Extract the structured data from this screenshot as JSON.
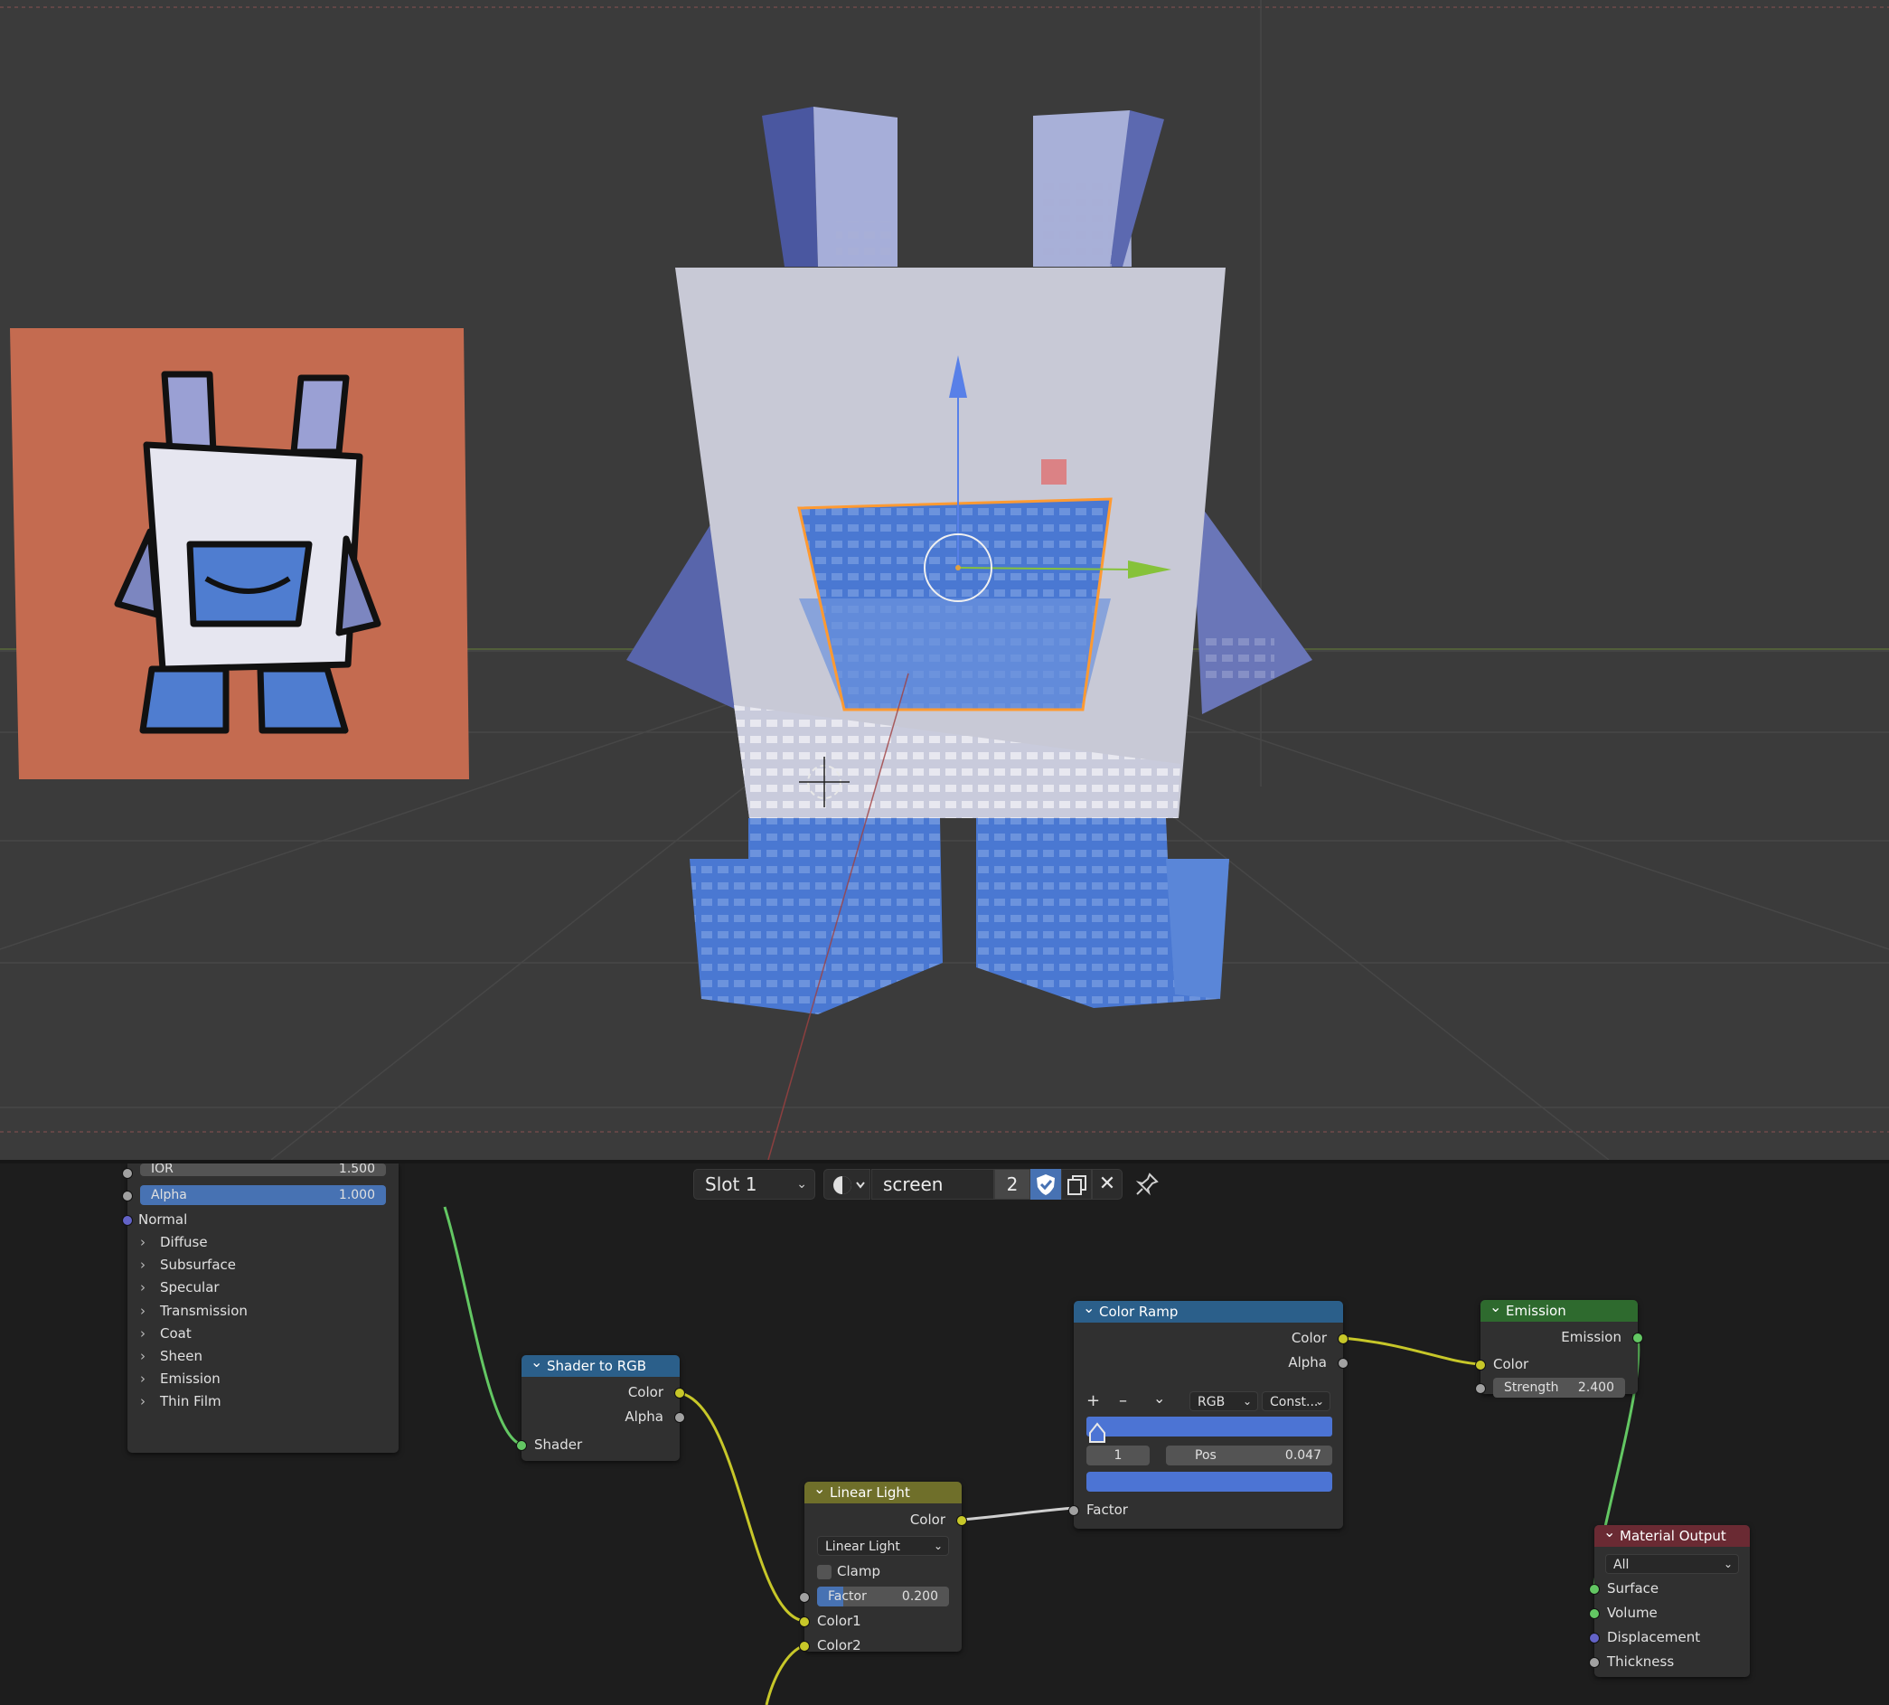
{
  "header": {
    "slot_label": "Slot 1",
    "material_name": "screen",
    "users_count": "2",
    "icons": [
      "material-sphere-icon",
      "fake-user-shield-icon",
      "duplicate-material-icon",
      "unlink-x-icon",
      "pin-icon"
    ]
  },
  "principled_panel": {
    "ior_label": "IOR",
    "ior_value": "1.500",
    "alpha_label": "Alpha",
    "alpha_value": "1.000",
    "normal_label": "Normal",
    "sections": [
      "Diffuse",
      "Subsurface",
      "Specular",
      "Transmission",
      "Coat",
      "Sheen",
      "Emission",
      "Thin Film"
    ]
  },
  "shader_to_rgb": {
    "title": "Shader to RGB",
    "out_color": "Color",
    "out_alpha": "Alpha",
    "in_shader": "Shader"
  },
  "linear_light": {
    "title": "Linear Light",
    "out_color": "Color",
    "blend_mode": "Linear Light",
    "clamp_label": "Clamp",
    "factor_label": "Factor",
    "factor_value": "0.200",
    "in_color1": "Color1",
    "in_color2": "Color2"
  },
  "color_ramp": {
    "title": "Color Ramp",
    "out_color": "Color",
    "out_alpha": "Alpha",
    "add_label": "+",
    "remove_label": "–",
    "color_mode": "RGB",
    "interpolation": "Const...",
    "stop_index": "1",
    "pos_label": "Pos",
    "pos_value": "0.047",
    "in_factor": "Factor",
    "stop_color": "#4c74d4"
  },
  "emission": {
    "title": "Emission",
    "out_emission": "Emission",
    "in_color": "Color",
    "strength_label": "Strength",
    "strength_value": "2.400"
  },
  "material_output": {
    "title": "Material Output",
    "target": "All",
    "in_surface": "Surface",
    "in_volume": "Volume",
    "in_displacement": "Displacement",
    "in_thickness": "Thickness"
  },
  "colors": {
    "viewport_bg": "#3b3b3b",
    "editor_bg": "#1d1d1d",
    "converter_header": "#2b5f8a",
    "color_header": "#6f6f2a",
    "shader_header": "#2e6a2e",
    "output_header": "#6a2a33",
    "accent_blue": "#4772b3",
    "reference_bg": "#c46b50"
  }
}
